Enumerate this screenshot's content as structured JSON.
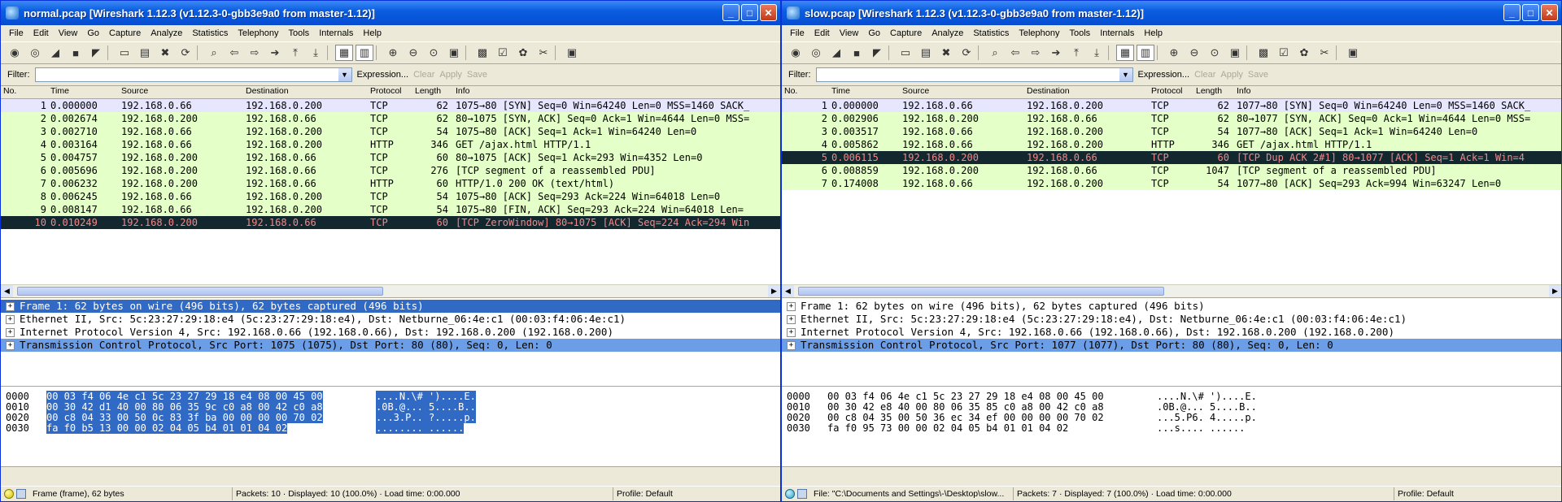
{
  "left": {
    "title": "normal.pcap   [Wireshark 1.12.3  (v1.12.3-0-gbb3e9a0 from master-1.12)]",
    "menu": [
      "File",
      "Edit",
      "View",
      "Go",
      "Capture",
      "Analyze",
      "Statistics",
      "Telephony",
      "Tools",
      "Internals",
      "Help"
    ],
    "filter": {
      "label": "Filter:",
      "value": "",
      "expression": "Expression...",
      "clear": "Clear",
      "apply": "Apply",
      "save": "Save"
    },
    "columns": [
      "No.",
      "Time",
      "Source",
      "Destination",
      "Protocol",
      "Length",
      "Info"
    ],
    "packets": [
      {
        "no": "1",
        "time": "0.000000",
        "src": "192.168.0.66",
        "dst": "192.168.0.200",
        "proto": "TCP",
        "len": "62",
        "info": "1075→80 [SYN] Seq=0 Win=64240 Len=0 MSS=1460 SACK_",
        "color": "purple"
      },
      {
        "no": "2",
        "time": "0.002674",
        "src": "192.168.0.200",
        "dst": "192.168.0.66",
        "proto": "TCP",
        "len": "62",
        "info": "80→1075 [SYN, ACK] Seq=0 Ack=1 Win=4644 Len=0 MSS=",
        "color": "green"
      },
      {
        "no": "3",
        "time": "0.002710",
        "src": "192.168.0.66",
        "dst": "192.168.0.200",
        "proto": "TCP",
        "len": "54",
        "info": "1075→80 [ACK] Seq=1 Ack=1 Win=64240 Len=0",
        "color": "green"
      },
      {
        "no": "4",
        "time": "0.003164",
        "src": "192.168.0.66",
        "dst": "192.168.0.200",
        "proto": "HTTP",
        "len": "346",
        "info": "GET /ajax.html HTTP/1.1",
        "color": "green"
      },
      {
        "no": "5",
        "time": "0.004757",
        "src": "192.168.0.200",
        "dst": "192.168.0.66",
        "proto": "TCP",
        "len": "60",
        "info": "80→1075 [ACK] Seq=1 Ack=293 Win=4352 Len=0",
        "color": "green"
      },
      {
        "no": "6",
        "time": "0.005696",
        "src": "192.168.0.200",
        "dst": "192.168.0.66",
        "proto": "TCP",
        "len": "276",
        "info": "[TCP segment of a reassembled PDU]",
        "color": "green"
      },
      {
        "no": "7",
        "time": "0.006232",
        "src": "192.168.0.200",
        "dst": "192.168.0.66",
        "proto": "HTTP",
        "len": "60",
        "info": "HTTP/1.0 200 OK  (text/html)",
        "color": "green"
      },
      {
        "no": "8",
        "time": "0.006245",
        "src": "192.168.0.66",
        "dst": "192.168.0.200",
        "proto": "TCP",
        "len": "54",
        "info": "1075→80 [ACK] Seq=293 Ack=224 Win=64018 Len=0",
        "color": "green"
      },
      {
        "no": "9",
        "time": "0.008147",
        "src": "192.168.0.66",
        "dst": "192.168.0.200",
        "proto": "TCP",
        "len": "54",
        "info": "1075→80 [FIN, ACK] Seq=293 Ack=224 Win=64018 Len=",
        "color": "green"
      },
      {
        "no": "10",
        "time": "0.010249",
        "src": "192.168.0.200",
        "dst": "192.168.0.66",
        "proto": "TCP",
        "len": "60",
        "info": "[TCP ZeroWindow] 80→1075 [ACK] Seq=224 Ack=294 Win",
        "color": "black"
      }
    ],
    "details": [
      {
        "text": "Frame 1: 62 bytes on wire (496 bits), 62 bytes captured (496 bits)",
        "sel": "sel2"
      },
      {
        "text": "Ethernet II, Src: 5c:23:27:29:18:e4 (5c:23:27:29:18:e4), Dst: Netburne_06:4e:c1 (00:03:f4:06:4e:c1)",
        "sel": ""
      },
      {
        "text": "Internet Protocol Version 4, Src: 192.168.0.66 (192.168.0.66), Dst: 192.168.0.200 (192.168.0.200)",
        "sel": ""
      },
      {
        "text": "Transmission Control Protocol, Src Port: 1075 (1075), Dst Port: 80 (80), Seq: 0, Len: 0",
        "sel": "sel"
      }
    ],
    "bytes": [
      {
        "off": "0000",
        "hex": "00 03 f4 06 4e c1 5c 23  27 29 18 e4 08 00 45 00",
        "asc": "....N.\\# ')....E."
      },
      {
        "off": "0010",
        "hex": "00 30 42 d1 40 00 80 06  35 9c c0 a8 00 42 c0 a8",
        "asc": ".0B.@... 5....B.."
      },
      {
        "off": "0020",
        "hex": "00 c8 04 33 00 50 0c 83  3f ba 00 00 00 00 70 02",
        "asc": "...3.P.. ?.....p."
      },
      {
        "off": "0030",
        "hex": "fa f0 b5 13 00 00 02 04  05 b4 01 01 04 02",
        "asc": "........ ......"
      }
    ],
    "status": {
      "file": "Frame (frame), 62 bytes",
      "packets": "Packets: 10 · Displayed: 10 (100.0%) · Load time: 0:00.000",
      "profile": "Profile: Default"
    }
  },
  "right": {
    "title": "slow.pcap   [Wireshark 1.12.3  (v1.12.3-0-gbb3e9a0 from master-1.12)]",
    "menu": [
      "File",
      "Edit",
      "View",
      "Go",
      "Capture",
      "Analyze",
      "Statistics",
      "Telephony",
      "Tools",
      "Internals",
      "Help"
    ],
    "filter": {
      "label": "Filter:",
      "value": "",
      "expression": "Expression...",
      "clear": "Clear",
      "apply": "Apply",
      "save": "Save"
    },
    "columns": [
      "No.",
      "Time",
      "Source",
      "Destination",
      "Protocol",
      "Length",
      "Info"
    ],
    "packets": [
      {
        "no": "1",
        "time": "0.000000",
        "src": "192.168.0.66",
        "dst": "192.168.0.200",
        "proto": "TCP",
        "len": "62",
        "info": "1077→80 [SYN] Seq=0 Win=64240 Len=0 MSS=1460 SACK_",
        "color": "purple"
      },
      {
        "no": "2",
        "time": "0.002906",
        "src": "192.168.0.200",
        "dst": "192.168.0.66",
        "proto": "TCP",
        "len": "62",
        "info": "80→1077 [SYN, ACK] Seq=0 Ack=1 Win=4644 Len=0 MSS=",
        "color": "green"
      },
      {
        "no": "3",
        "time": "0.003517",
        "src": "192.168.0.66",
        "dst": "192.168.0.200",
        "proto": "TCP",
        "len": "54",
        "info": "1077→80 [ACK] Seq=1 Ack=1 Win=64240 Len=0",
        "color": "green"
      },
      {
        "no": "4",
        "time": "0.005862",
        "src": "192.168.0.66",
        "dst": "192.168.0.200",
        "proto": "HTTP",
        "len": "346",
        "info": "GET /ajax.html HTTP/1.1",
        "color": "green"
      },
      {
        "no": "5",
        "time": "0.006115",
        "src": "192.168.0.200",
        "dst": "192.168.0.66",
        "proto": "TCP",
        "len": "60",
        "info": "[TCP Dup ACK 2#1] 80→1077 [ACK] Seq=1 Ack=1 Win=4",
        "color": "black"
      },
      {
        "no": "6",
        "time": "0.008859",
        "src": "192.168.0.200",
        "dst": "192.168.0.66",
        "proto": "TCP",
        "len": "1047",
        "info": "[TCP segment of a reassembled PDU]",
        "color": "green"
      },
      {
        "no": "7",
        "time": "0.174008",
        "src": "192.168.0.66",
        "dst": "192.168.0.200",
        "proto": "TCP",
        "len": "54",
        "info": "1077→80 [ACK] Seq=293 Ack=994 Win=63247 Len=0",
        "color": "green"
      }
    ],
    "details": [
      {
        "text": "Frame 1: 62 bytes on wire (496 bits), 62 bytes captured (496 bits)",
        "sel": ""
      },
      {
        "text": "Ethernet II, Src: 5c:23:27:29:18:e4 (5c:23:27:29:18:e4), Dst: Netburne_06:4e:c1 (00:03:f4:06:4e:c1)",
        "sel": ""
      },
      {
        "text": "Internet Protocol Version 4, Src: 192.168.0.66 (192.168.0.66), Dst: 192.168.0.200 (192.168.0.200)",
        "sel": ""
      },
      {
        "text": "Transmission Control Protocol, Src Port: 1077 (1077), Dst Port: 80 (80), Seq: 0, Len: 0",
        "sel": "sel"
      }
    ],
    "bytes": [
      {
        "off": "0000",
        "hex": "00 03 f4 06 4e c1 5c 23  27 29 18 e4 08 00 45 00",
        "asc": "....N.\\# ')....E."
      },
      {
        "off": "0010",
        "hex": "00 30 42 e8 40 00 80 06  35 85 c0 a8 00 42 c0 a8",
        "asc": ".0B.@... 5....B.."
      },
      {
        "off": "0020",
        "hex": "00 c8 04 35 00 50 36 ec  34 ef 00 00 00 00 70 02",
        "asc": "...5.P6. 4.....p."
      },
      {
        "off": "0030",
        "hex": "fa f0 95 73 00 00 02 04  05 b4 01 01 04 02",
        "asc": "...s.... ......"
      }
    ],
    "status": {
      "file": "File: \"C:\\Documents and Settings\\-\\Desktop\\slow...",
      "packets": "Packets: 7 · Displayed: 7 (100.0%) · Load time: 0:00.000",
      "profile": "Profile: Default"
    }
  },
  "icons": [
    "interfaces-icon",
    "options-icon",
    "start-capture-icon",
    "stop-capture-icon",
    "restart-icon",
    "open-icon",
    "save-icon",
    "close-file-icon",
    "reload-icon",
    "find-icon",
    "back-icon",
    "forward-icon",
    "goto-icon",
    "first-icon",
    "last-icon",
    "colorize-icon",
    "autoscroll-icon",
    "zoom-in-icon",
    "zoom-out-icon",
    "normal-size-icon",
    "resize-columns-icon",
    "capture-filters-icon",
    "display-filters-icon",
    "coloring-rules-icon",
    "preferences-icon",
    "help-icon"
  ]
}
